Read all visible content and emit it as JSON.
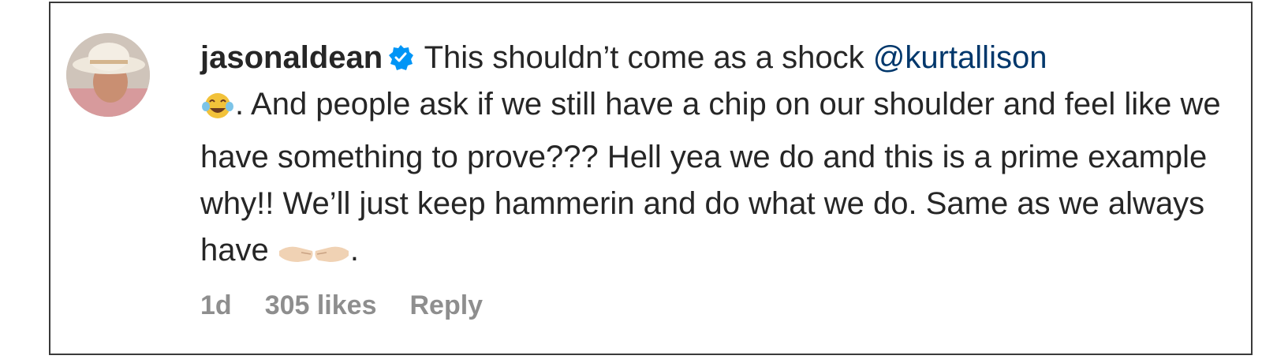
{
  "comment": {
    "username": "jasonaldean",
    "verified": true,
    "text_part1": " This shouldn’t come as a shock ",
    "mention": "@kurtallison",
    "text_part2": ". And people ask if we still have a chip on our shoulder and feel like we have something to prove??? Hell yea we do and this is a prime example why!! We’ll just keep hammerin and do what we do. Same as we always have ",
    "text_part3": ".",
    "emoji_1": "face-with-tears-of-joy",
    "emoji_2": "fist-bump"
  },
  "meta": {
    "age": "1d",
    "likes": "305 likes",
    "reply_label": "Reply"
  },
  "colors": {
    "text": "#262626",
    "secondary": "#8e8e8e",
    "mention": "#00376b",
    "verified": "#0095f6"
  }
}
